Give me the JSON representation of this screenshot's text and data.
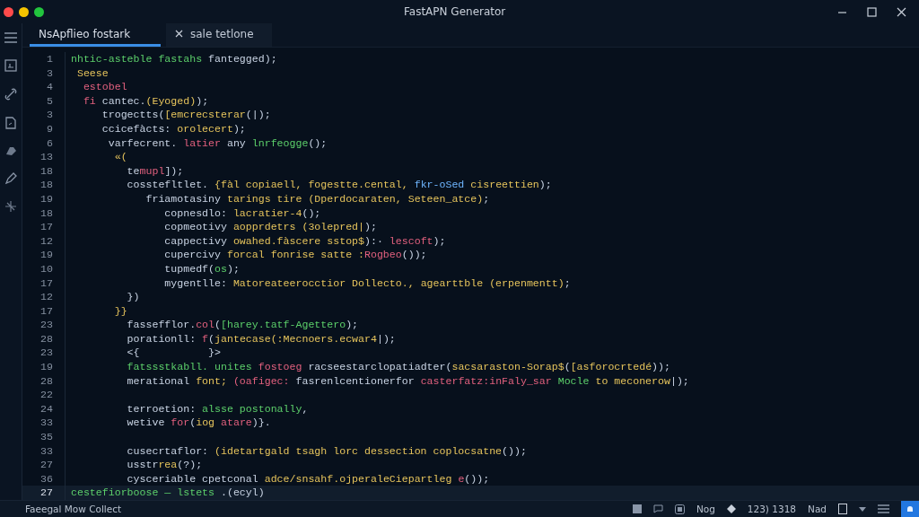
{
  "window": {
    "title": "FastAPN Generator"
  },
  "tabs": [
    {
      "label": "NsApflieo fostark",
      "selected": true
    },
    {
      "label": "sale tetlone",
      "selected": false
    }
  ],
  "editor": {
    "lines": [
      {
        "number": "1",
        "current": false,
        "tokens": [
          {
            "kind": "func",
            "text": "nhtic-asteble fastahs "
          },
          {
            "kind": "plain",
            "text": "fantegged);"
          }
        ]
      },
      {
        "number": "3",
        "current": false,
        "tokens": [
          {
            "kind": "string",
            "text": " Seese"
          }
        ]
      },
      {
        "number": "4",
        "current": false,
        "tokens": [
          {
            "kind": "keyword",
            "text": "  estobel"
          }
        ]
      },
      {
        "number": "5",
        "current": false,
        "tokens": [
          {
            "kind": "keyword",
            "text": "  fi "
          },
          {
            "kind": "plain",
            "text": "cantec."
          },
          {
            "kind": "string",
            "text": "(Eyoged)"
          },
          {
            "kind": "plain",
            "text": ");"
          }
        ]
      },
      {
        "number": "3",
        "current": false,
        "tokens": [
          {
            "kind": "plain",
            "text": "     trogectts("
          },
          {
            "kind": "string",
            "text": "[emcrecsterar"
          },
          {
            "kind": "plain",
            "text": "(|);"
          }
        ]
      },
      {
        "number": "9",
        "current": false,
        "tokens": [
          {
            "kind": "plain",
            "text": "     ccicefàcts: "
          },
          {
            "kind": "string",
            "text": "orolecert"
          },
          {
            "kind": "plain",
            "text": ");"
          }
        ]
      },
      {
        "number": "6",
        "current": false,
        "tokens": [
          {
            "kind": "plain",
            "text": "      varfecrent. "
          },
          {
            "kind": "keyword",
            "text": "latier "
          },
          {
            "kind": "plain",
            "text": "any "
          },
          {
            "kind": "func",
            "text": "lnrfeogge"
          },
          {
            "kind": "plain",
            "text": "();"
          }
        ]
      },
      {
        "number": "13",
        "current": false,
        "tokens": [
          {
            "kind": "string",
            "text": "       «("
          }
        ]
      },
      {
        "number": "18",
        "current": false,
        "tokens": [
          {
            "kind": "plain",
            "text": "         te"
          },
          {
            "kind": "keyword",
            "text": "mupl"
          },
          {
            "kind": "plain",
            "text": "]);"
          }
        ]
      },
      {
        "number": "18",
        "current": false,
        "tokens": [
          {
            "kind": "plain",
            "text": "         cosstefltlet. "
          },
          {
            "kind": "string",
            "text": "{fàl copiaell, fogestte.cental, "
          },
          {
            "kind": "type",
            "text": "fkr-oSed "
          },
          {
            "kind": "string",
            "text": "cisreettien"
          },
          {
            "kind": "plain",
            "text": ");"
          }
        ]
      },
      {
        "number": "19",
        "current": false,
        "tokens": [
          {
            "kind": "plain",
            "text": "            friamotasiny "
          },
          {
            "kind": "string",
            "text": "tarings tire (Dperdocaraten, Seteen_atce)"
          },
          {
            "kind": "plain",
            "text": ";"
          }
        ]
      },
      {
        "number": "18",
        "current": false,
        "tokens": [
          {
            "kind": "plain",
            "text": "               copnesdlo: "
          },
          {
            "kind": "string",
            "text": "lacratier-4"
          },
          {
            "kind": "plain",
            "text": "();"
          }
        ]
      },
      {
        "number": "17",
        "current": false,
        "tokens": [
          {
            "kind": "plain",
            "text": "               copmeotivy "
          },
          {
            "kind": "string",
            "text": "aopprdetrs (3olepred|"
          },
          {
            "kind": "plain",
            "text": ");"
          }
        ]
      },
      {
        "number": "12",
        "current": false,
        "tokens": [
          {
            "kind": "plain",
            "text": "               cappectivy "
          },
          {
            "kind": "string",
            "text": "owahed.fàscere sstop$"
          },
          {
            "kind": "plain",
            "text": "):· "
          },
          {
            "kind": "keyword",
            "text": "lescoft"
          },
          {
            "kind": "plain",
            "text": ");"
          }
        ]
      },
      {
        "number": "19",
        "current": false,
        "tokens": [
          {
            "kind": "plain",
            "text": "               cupercivy "
          },
          {
            "kind": "string",
            "text": "forcal fonrise satte :"
          },
          {
            "kind": "keyword",
            "text": "Rogbeo"
          },
          {
            "kind": "plain",
            "text": "());"
          }
        ]
      },
      {
        "number": "10",
        "current": false,
        "tokens": [
          {
            "kind": "plain",
            "text": "               tupmedf("
          },
          {
            "kind": "func",
            "text": "os"
          },
          {
            "kind": "plain",
            "text": ");"
          }
        ]
      },
      {
        "number": "17",
        "current": false,
        "tokens": [
          {
            "kind": "plain",
            "text": "               mygentlle: "
          },
          {
            "kind": "string",
            "text": "Matoreateerocctior Dollecto., agearttble (erpenmentt)"
          },
          {
            "kind": "plain",
            "text": ";"
          }
        ]
      },
      {
        "number": "12",
        "current": false,
        "tokens": [
          {
            "kind": "plain",
            "text": "         })"
          }
        ]
      },
      {
        "number": "17",
        "current": false,
        "tokens": [
          {
            "kind": "string",
            "text": "       }}"
          }
        ]
      },
      {
        "number": "23",
        "current": false,
        "tokens": [
          {
            "kind": "plain",
            "text": "         fassefflor."
          },
          {
            "kind": "keyword",
            "text": "col"
          },
          {
            "kind": "plain",
            "text": "("
          },
          {
            "kind": "func",
            "text": "[harey.tatf-Agettero"
          },
          {
            "kind": "plain",
            "text": ");"
          }
        ]
      },
      {
        "number": "28",
        "current": false,
        "tokens": [
          {
            "kind": "plain",
            "text": "         porationll: "
          },
          {
            "kind": "keyword",
            "text": "f"
          },
          {
            "kind": "plain",
            "text": "("
          },
          {
            "kind": "string",
            "text": "jantecase(:Mecnoers.ecwar4"
          },
          {
            "kind": "plain",
            "text": "|);"
          }
        ]
      },
      {
        "number": "23",
        "current": false,
        "tokens": [
          {
            "kind": "plain",
            "text": "         <{           }>"
          }
        ]
      },
      {
        "number": "19",
        "current": false,
        "tokens": [
          {
            "kind": "func",
            "text": "         fatssstkabll. unites "
          },
          {
            "kind": "keyword",
            "text": "fostoeg "
          },
          {
            "kind": "plain",
            "text": "racseestarclopatiadter("
          },
          {
            "kind": "string",
            "text": "sacsaraston-Sorap$"
          },
          {
            "kind": "plain",
            "text": "("
          },
          {
            "kind": "string",
            "text": "[asforocrtedé"
          },
          {
            "kind": "plain",
            "text": "));"
          }
        ]
      },
      {
        "number": "28",
        "current": false,
        "tokens": [
          {
            "kind": "plain",
            "text": "         merational "
          },
          {
            "kind": "string",
            "text": "font;"
          },
          {
            "kind": "keyword",
            "text": " (oafigec: "
          },
          {
            "kind": "plain",
            "text": "fasrenlcentionerfor "
          },
          {
            "kind": "keyword",
            "text": "casterfatz:inFaly_sar "
          },
          {
            "kind": "func",
            "text": "Mocle "
          },
          {
            "kind": "string",
            "text": "to meconerow"
          },
          {
            "kind": "plain",
            "text": "|);"
          }
        ]
      },
      {
        "number": "22",
        "current": false
      },
      {
        "number": "24",
        "current": false,
        "tokens": [
          {
            "kind": "plain",
            "text": "         terroetion: "
          },
          {
            "kind": "func",
            "text": "alsse postonally"
          },
          {
            "kind": "plain",
            "text": ","
          }
        ]
      },
      {
        "number": "33",
        "current": false,
        "tokens": [
          {
            "kind": "plain",
            "text": "         wetive "
          },
          {
            "kind": "keyword",
            "text": "for"
          },
          {
            "kind": "plain",
            "text": "("
          },
          {
            "kind": "string",
            "text": "iog "
          },
          {
            "kind": "keyword",
            "text": "atare"
          },
          {
            "kind": "plain",
            "text": ")}."
          }
        ]
      },
      {
        "number": "35",
        "current": false
      },
      {
        "number": "33",
        "current": false,
        "tokens": [
          {
            "kind": "plain",
            "text": "         cusecrtaflor: "
          },
          {
            "kind": "string",
            "text": "(idetartgald tsagh lorc dessection coplocsatne"
          },
          {
            "kind": "plain",
            "text": "());"
          }
        ]
      },
      {
        "number": "27",
        "current": false,
        "tokens": [
          {
            "kind": "plain",
            "text": "         usstr"
          },
          {
            "kind": "string",
            "text": "rea"
          },
          {
            "kind": "plain",
            "text": "(?);"
          }
        ]
      },
      {
        "number": "36",
        "current": false,
        "tokens": [
          {
            "kind": "plain",
            "text": "         cysceriable cpetconal "
          },
          {
            "kind": "string",
            "text": "adce/snsahf.ojperaleCiepartleg "
          },
          {
            "kind": "keyword",
            "text": "e"
          },
          {
            "kind": "plain",
            "text": "());"
          }
        ]
      },
      {
        "number": "27",
        "current": true,
        "tokens": [
          {
            "kind": "func",
            "text": "cestefiorboose — lstets "
          },
          {
            "kind": "plain",
            "text": ".(ecyl)"
          }
        ]
      }
    ]
  },
  "status_bar": {
    "message": "Faeegal Mow Collect",
    "items": [
      "Nog",
      "123) 1318",
      "Nad"
    ]
  }
}
